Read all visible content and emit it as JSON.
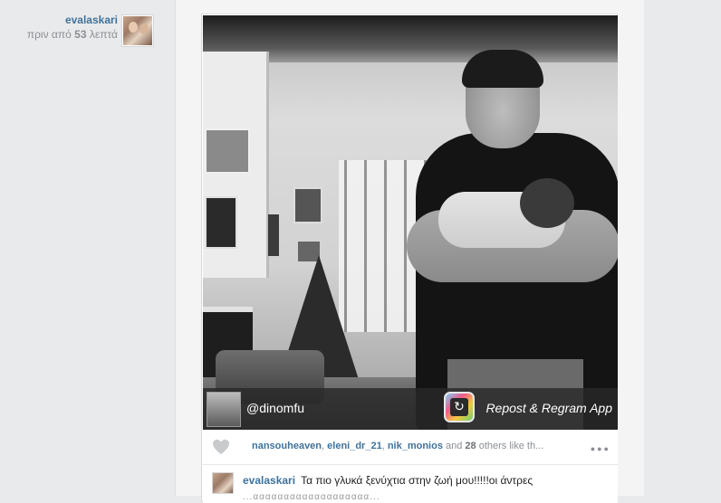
{
  "post_meta": {
    "username": "evalaskari",
    "time_prefix": "πριν από ",
    "time_number": "53",
    "time_suffix": " λεπτά"
  },
  "photo": {
    "credit_handle": "@dinomfu",
    "credit_app_name": "Repost & Regram App",
    "app_icon_glyph": "↻"
  },
  "likes": {
    "likers": [
      "nansouheaven",
      "eleni_dr_21",
      "nik_monios"
    ],
    "and_text": " and ",
    "others_count": "28",
    "others_text": " others like th...",
    "more_label": "●●●"
  },
  "comment": {
    "username": "evalaskari",
    "text": "Τα πιο γλυκά ξενύχτια στην ζωή μου!!!!!οι άντρες",
    "line2": "...ααααααααααααααααααα..."
  },
  "colors": {
    "link": "#3f729b",
    "muted": "#8b8f94",
    "page_bg": "#e9eaeb"
  }
}
